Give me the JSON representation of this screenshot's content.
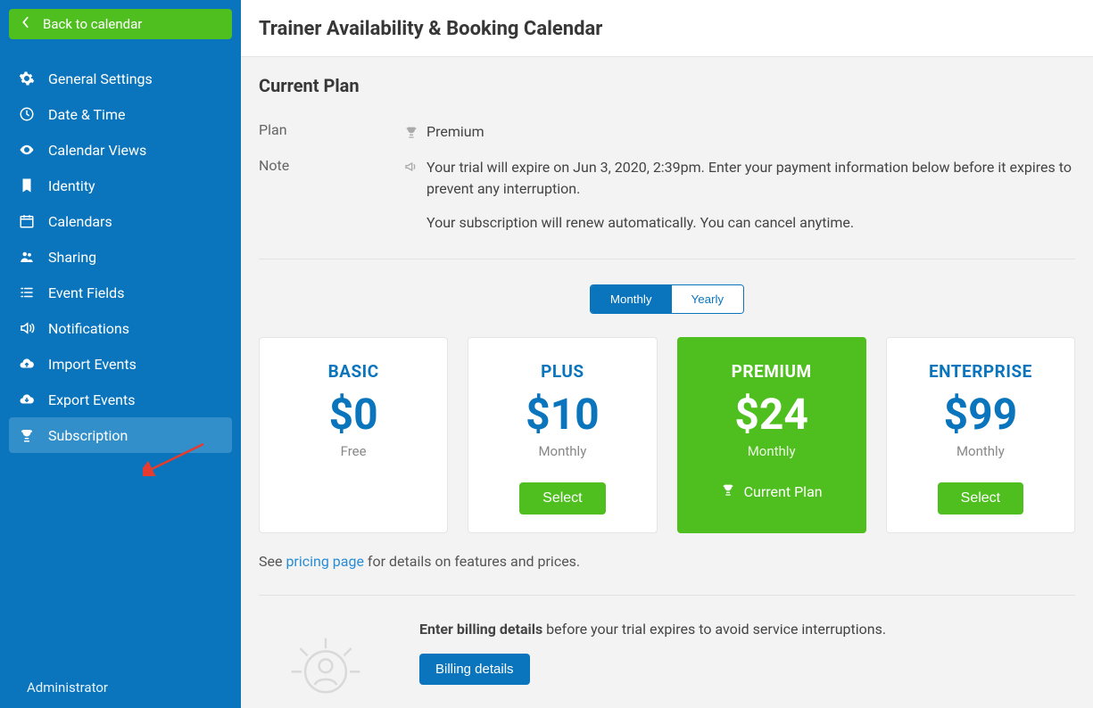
{
  "back_button": {
    "label": "Back to calendar"
  },
  "sidebar": {
    "items": [
      {
        "label": "General Settings",
        "icon": "gear-icon"
      },
      {
        "label": "Date & Time",
        "icon": "clock-icon"
      },
      {
        "label": "Calendar Views",
        "icon": "eye-icon"
      },
      {
        "label": "Identity",
        "icon": "bookmark-icon"
      },
      {
        "label": "Calendars",
        "icon": "calendar-icon"
      },
      {
        "label": "Sharing",
        "icon": "users-icon"
      },
      {
        "label": "Event Fields",
        "icon": "list-icon"
      },
      {
        "label": "Notifications",
        "icon": "sound-icon"
      },
      {
        "label": "Import Events",
        "icon": "cloud-up-icon"
      },
      {
        "label": "Export Events",
        "icon": "cloud-down-icon"
      },
      {
        "label": "Subscription",
        "icon": "trophy-icon",
        "active": true
      }
    ],
    "footer_role": "Administrator"
  },
  "header": {
    "title": "Trainer Availability & Booking Calendar"
  },
  "current_plan": {
    "section_title": "Current Plan",
    "plan_label": "Plan",
    "plan_value": "Premium",
    "note_label": "Note",
    "note_line1": "Your trial will expire on Jun 3, 2020, 2:39pm. Enter your payment information below before it expires to prevent any interruption.",
    "note_line2": "Your subscription will renew automatically. You can cancel anytime."
  },
  "billing_toggle": {
    "monthly_label": "Monthly",
    "yearly_label": "Yearly",
    "selected": "Monthly"
  },
  "plans": [
    {
      "tier": "BASIC",
      "price": "$0",
      "period": "Free",
      "select_label": "",
      "is_current": false,
      "show_select": false
    },
    {
      "tier": "PLUS",
      "price": "$10",
      "period": "Monthly",
      "select_label": "Select",
      "is_current": false,
      "show_select": true
    },
    {
      "tier": "PREMIUM",
      "price": "$24",
      "period": "Monthly",
      "select_label": "",
      "is_current": true,
      "current_label": "Current Plan",
      "show_select": false
    },
    {
      "tier": "ENTERPRISE",
      "price": "$99",
      "period": "Monthly",
      "select_label": "Select",
      "is_current": false,
      "show_select": true
    }
  ],
  "pricing_note": {
    "before": "See ",
    "link_text": "pricing page",
    "after": " for details on features and prices."
  },
  "billing": {
    "bold": "Enter billing details",
    "rest": " before your trial expires to avoid service interruptions.",
    "button_label": "Billing details"
  },
  "colors": {
    "sidebar_blue": "#0a75bc",
    "green": "#4fbf1f",
    "link": "#2a8dd4"
  }
}
